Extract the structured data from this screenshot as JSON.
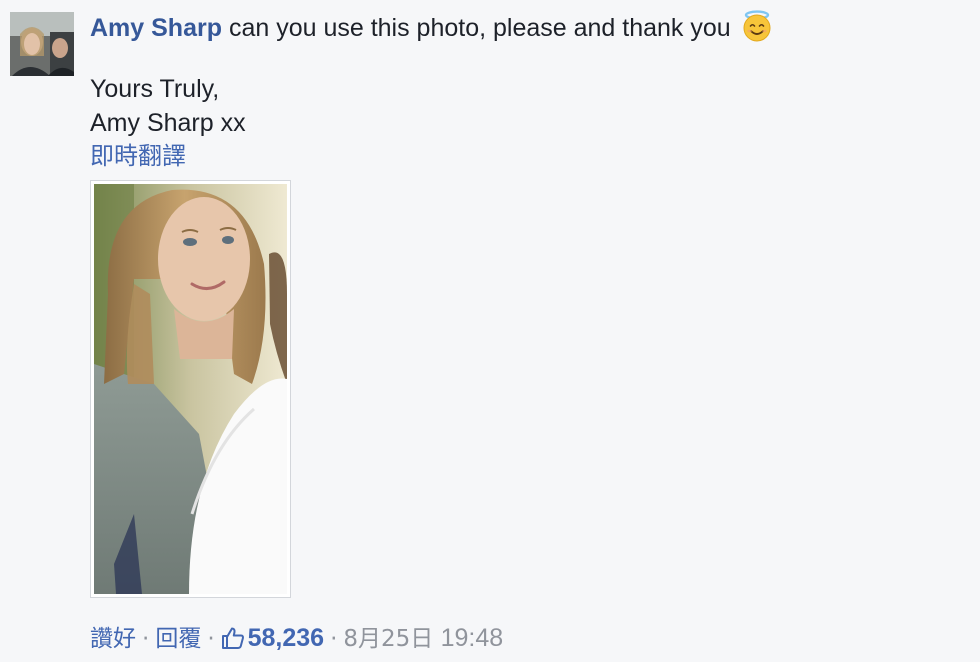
{
  "comment": {
    "author": "Amy Sharp",
    "text": "can you use this photo, please and thank you",
    "emoji": "smiling-face-with-halo",
    "body_line1": "Yours Truly,",
    "body_line2": "Amy Sharp xx",
    "translate_label": "即時翻譯"
  },
  "actions": {
    "like_label": "讚好",
    "reply_label": "回覆",
    "like_count": "58,236",
    "date": "8月25日",
    "time": "19:48"
  },
  "colors": {
    "background": "#f6f7f9",
    "link": "#4267b2",
    "author": "#365899",
    "meta": "#90949c"
  }
}
